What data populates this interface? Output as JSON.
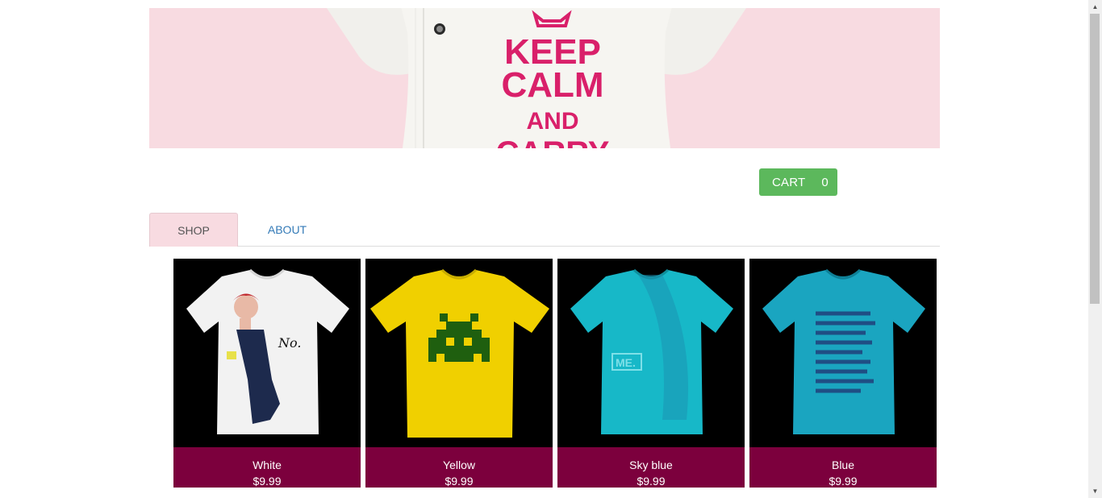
{
  "banner": {
    "slogan": [
      "KEEP",
      "CALM",
      "AND",
      "CARRY"
    ],
    "background_color": "#f8dbe1",
    "text_color": "#d9206a"
  },
  "cart": {
    "label": "CART",
    "count": "0",
    "color": "#5cb85c"
  },
  "tabs": [
    {
      "label": "SHOP",
      "active": true
    },
    {
      "label": "ABOUT",
      "active": false
    }
  ],
  "products": [
    {
      "name": "White",
      "price": "$9.99",
      "shirt_color": "#f2f2f2",
      "graphic": "pinup-girl"
    },
    {
      "name": "Yellow",
      "price": "$9.99",
      "shirt_color": "#f0d000",
      "graphic": "space-invader"
    },
    {
      "name": "Sky blue",
      "price": "$9.99",
      "shirt_color": "#17b8c8",
      "graphic": "me-print"
    },
    {
      "name": "Blue",
      "price": "$9.99",
      "shirt_color": "#1aa5c0",
      "graphic": "lorem-ipsum-text"
    }
  ],
  "colors": {
    "caption_bg": "#7c003d",
    "link": "#337ab7"
  }
}
